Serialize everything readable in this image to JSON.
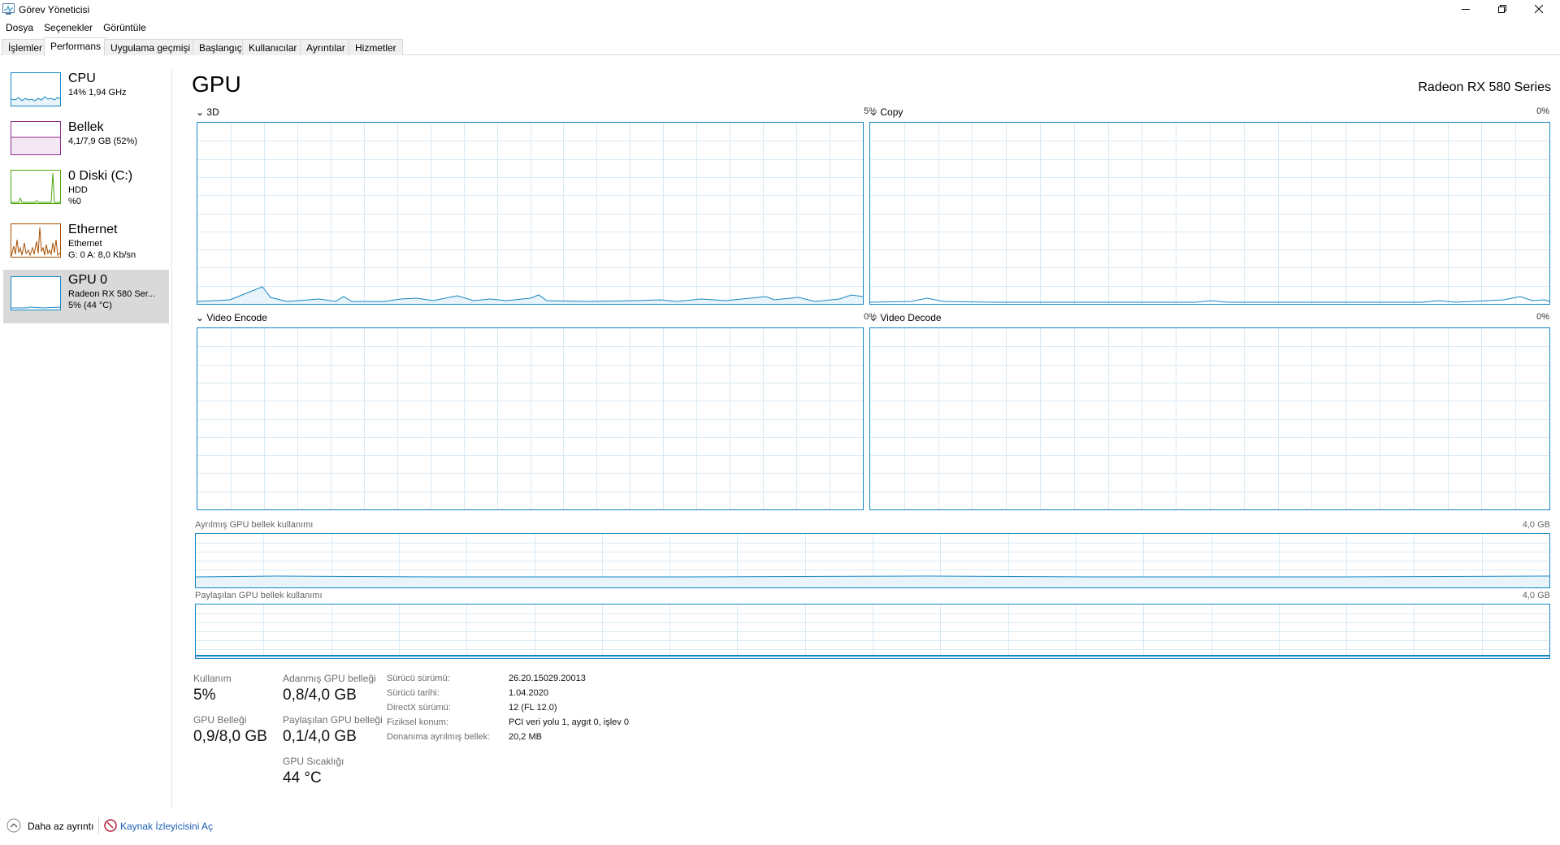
{
  "window": {
    "title": "Görev Yöneticisi"
  },
  "menu": [
    "Dosya",
    "Seçenekler",
    "Görüntüle"
  ],
  "tabs": [
    "İşlemler",
    "Performans",
    "Uygulama geçmişi",
    "Başlangıç",
    "Kullanıcılar",
    "Ayrıntılar",
    "Hizmetler"
  ],
  "active_tab": "Performans",
  "sidebar": {
    "items": [
      {
        "name": "CPU",
        "sub1": "14%  1,94 GHz",
        "sub2": "",
        "color": "#1587c4"
      },
      {
        "name": "Bellek",
        "sub1": "4,1/7,9 GB (52%)",
        "sub2": "",
        "color": "#8b2e8b"
      },
      {
        "name": "0 Diski (C:)",
        "sub1": "HDD",
        "sub2": "%0",
        "color": "#4da60c"
      },
      {
        "name": "Ethernet",
        "sub1": "Ethernet",
        "sub2": "G: 0  A: 8,0 Kb/sn",
        "color": "#a74f01"
      },
      {
        "name": "GPU 0",
        "sub1": "Radeon RX 580 Ser...",
        "sub2": "5% (44 °C)",
        "color": "#1587c4"
      }
    ]
  },
  "main": {
    "title": "GPU",
    "model": "Radeon RX 580 Series",
    "graphs": [
      {
        "label": "3D",
        "pct": "5%"
      },
      {
        "label": "Copy",
        "pct": "0%"
      },
      {
        "label": "Video Encode",
        "pct": "0%"
      },
      {
        "label": "Video Decode",
        "pct": "0%"
      }
    ],
    "dedicated_mem": {
      "label": "Ayrılmış GPU bellek kullanımı",
      "max": "4,0 GB"
    },
    "shared_mem": {
      "label": "Paylaşılan GPU bellek kullanımı",
      "max": "4,0 GB"
    }
  },
  "stats": {
    "usage_label": "Kullanım",
    "usage_value": "5%",
    "dedicated_label": "Adanmış GPU belleği",
    "dedicated_value": "0,8/4,0 GB",
    "gpu_mem_label": "GPU Belleği",
    "gpu_mem_value": "0,9/8,0 GB",
    "shared_label": "Paylaşılan GPU belleği",
    "shared_value": "0,1/4,0 GB",
    "temp_label": "GPU Sıcaklığı",
    "temp_value": "44 °C"
  },
  "info": [
    {
      "label": "Sürücü sürümü:",
      "value": "26.20.15029.20013"
    },
    {
      "label": "Sürücü tarihi:",
      "value": "1.04.2020"
    },
    {
      "label": "DirectX sürümü:",
      "value": "12 (FL 12.0)"
    },
    {
      "label": "Fiziksel konum:",
      "value": "PCI veri yolu 1, aygıt 0, işlev 0"
    },
    {
      "label": "Donanıma ayrılmış bellek:",
      "value": "20,2 MB"
    }
  ],
  "footer": {
    "less_details": "Daha az ayrıntı",
    "resource_monitor": "Kaynak İzleyicisini Aç"
  }
}
